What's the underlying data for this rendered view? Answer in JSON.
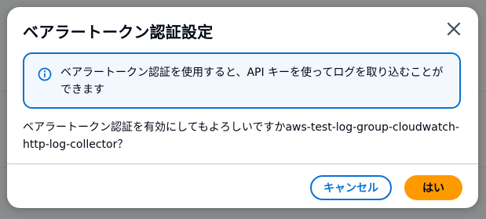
{
  "dialog": {
    "title": "ベアラートークン認証設定",
    "close_icon": "close-icon",
    "alert": {
      "icon": "info-icon",
      "text": "ベアラートークン認証を使用すると、API キーを使ってログを取り込むことができます"
    },
    "message": "ベアラートークン認証を有効にしてもよろしいですかaws-test-log-group-cloudwatch-http-log-collector？",
    "buttons": {
      "cancel_label": "キャンセル",
      "confirm_label": "はい"
    },
    "colors": {
      "accent": "#0972d3",
      "primary_button": "#ff9900",
      "alert_background": "#f2f8fd"
    }
  }
}
